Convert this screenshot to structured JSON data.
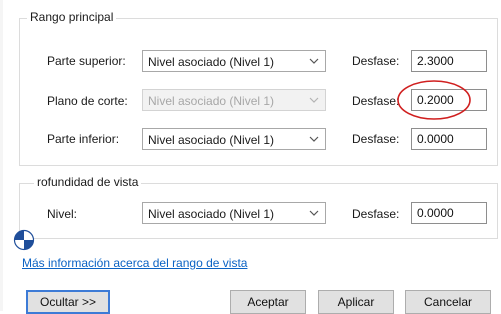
{
  "main_range": {
    "title": "Rango principal",
    "top": {
      "label": "Parte superior:",
      "level": "Nivel asociado (Nivel 1)",
      "offset_label": "Desfase:",
      "offset_value": "2.3000"
    },
    "cut_plane": {
      "label": "Plano de corte:",
      "level": "Nivel asociado (Nivel 1)",
      "offset_label": "Desfase:",
      "offset_value": "0.2000"
    },
    "bottom": {
      "label": "Parte inferior:",
      "level": "Nivel asociado (Nivel 1)",
      "offset_label": "Desfase:",
      "offset_value": "0.0000"
    }
  },
  "view_depth": {
    "title": "rofundidad de vista",
    "level": {
      "label": "Nivel:",
      "value": "Nivel asociado (Nivel 1)",
      "offset_label": "Desfase:",
      "offset_value": "0.0000"
    }
  },
  "more_info_link": "Más información acerca del rango de vista",
  "buttons": {
    "hide": "Ocultar >>",
    "ok": "Aceptar",
    "apply": "Aplicar",
    "cancel": "Cancelar"
  },
  "colors": {
    "highlight_circle": "#d01f1f",
    "link": "#0b63c4",
    "default_button_border": "#3d7bd6"
  },
  "icons": {
    "combo_arrow": "chevron-down-icon",
    "cursor_marker": "revit-cursor-icon"
  }
}
